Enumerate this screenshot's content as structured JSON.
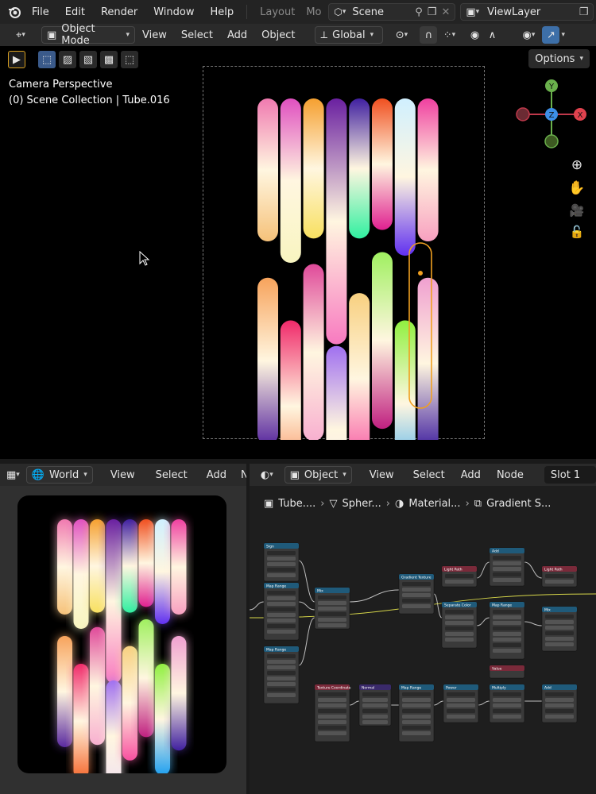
{
  "topbar": {
    "menus": [
      "File",
      "Edit",
      "Render",
      "Window",
      "Help"
    ],
    "workspaces": [
      "Layout",
      "Mo"
    ],
    "scene": "Scene",
    "view_layer": "ViewLayer"
  },
  "viewport_header": {
    "mode": "Object Mode",
    "menus": [
      "View",
      "Select",
      "Add",
      "Object"
    ],
    "transform_orientation": "Global"
  },
  "viewport": {
    "options_label": "Options",
    "line1": "Camera Perspective",
    "line2": "(0) Scene Collection | Tube.016"
  },
  "gizmo": {
    "x": "X",
    "y": "Y",
    "z": "Z"
  },
  "world_editor": {
    "type": "World",
    "menus": [
      "View",
      "Select",
      "Add",
      "N"
    ]
  },
  "node_editor": {
    "type": "Object",
    "menus": [
      "View",
      "Select",
      "Add",
      "Node"
    ],
    "slot": "Slot 1",
    "breadcrumbs": [
      "Tube....",
      "Spher...",
      "Material...",
      "Gradient S..."
    ]
  },
  "nodes": [
    {
      "title": "Sign",
      "color": "#1f5a7a"
    },
    {
      "title": "Map Range",
      "color": "#1f5a7a"
    },
    {
      "title": "Map Range",
      "color": "#1f5a7a"
    },
    {
      "title": "Mix",
      "color": "#1f5a7a"
    },
    {
      "title": "Texture Coordinate",
      "color": "#7a2a3a"
    },
    {
      "title": "Normal",
      "color": "#3a2a6a"
    },
    {
      "title": "Map Range",
      "color": "#1f5a7a"
    },
    {
      "title": "Gradient Texture",
      "color": "#1f5a7a"
    },
    {
      "title": "Light Path",
      "color": "#7a2a3a"
    },
    {
      "title": "Separate Color",
      "color": "#1f5a7a"
    },
    {
      "title": "Power",
      "color": "#1f5a7a"
    },
    {
      "title": "Add",
      "color": "#1f5a7a"
    },
    {
      "title": "Map Range",
      "color": "#1f5a7a"
    },
    {
      "title": "Value",
      "color": "#7a2a3a"
    },
    {
      "title": "Multiply",
      "color": "#1f5a7a"
    },
    {
      "title": "Light Path",
      "color": "#7a2a3a"
    },
    {
      "title": "Mix",
      "color": "#1f5a7a"
    },
    {
      "title": "Add",
      "color": "#1f5a7a"
    }
  ],
  "tube_colors": [
    [
      "#f07ab0",
      "#f6c27a"
    ],
    [
      "#f7a35c",
      "#5a2aa0"
    ],
    [
      "#e050c0",
      "#f8f5c0"
    ],
    [
      "#f02a6a",
      "#f56a30"
    ],
    [
      "#f5a030",
      "#f8e060"
    ],
    [
      "#e04a9a",
      "#f8b0d0"
    ],
    [
      "#6a20a0",
      "#f87ac0"
    ],
    [
      "#a070f0",
      "#f0e0f0"
    ],
    [
      "#4020a0",
      "#30f0a0"
    ],
    [
      "#f8d080",
      "#f850a0"
    ],
    [
      "#f05020",
      "#e02090"
    ],
    [
      "#a0f060",
      "#c02080"
    ],
    [
      "#d0f0ff",
      "#6030f0"
    ],
    [
      "#90f040",
      "#20a0f0"
    ],
    [
      "#f040a0",
      "#f8a0c0"
    ],
    [
      "#f0a0d0",
      "#4020a0"
    ]
  ]
}
